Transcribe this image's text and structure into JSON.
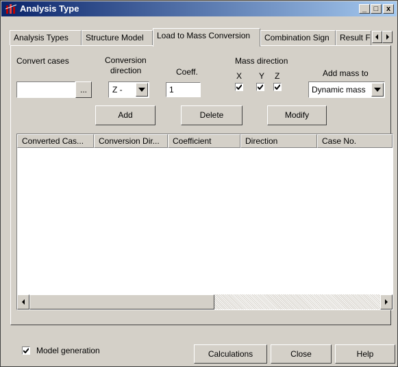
{
  "window": {
    "title": "Analysis Type",
    "minimize": "_",
    "maximize": "□",
    "close": "x"
  },
  "tabs": [
    {
      "label": "Analysis Types"
    },
    {
      "label": "Structure Model"
    },
    {
      "label": "Load to Mass Conversion"
    },
    {
      "label": "Combination Sign"
    },
    {
      "label": "Result F"
    }
  ],
  "form": {
    "convert_cases_label": "Convert cases",
    "convert_cases_value": "",
    "browse_label": "...",
    "conversion_direction_label_1": "Conversion",
    "conversion_direction_label_2": "direction",
    "conversion_direction_value": "Z -",
    "coeff_label": "Coeff.",
    "coeff_value": "1",
    "mass_direction_label": "Mass direction",
    "x_label": "X",
    "y_label": "Y",
    "z_label": "Z",
    "x_checked": true,
    "y_checked": true,
    "z_checked": true,
    "add_mass_to_label": "Add mass to",
    "add_mass_to_value": "Dynamic mass"
  },
  "buttons": {
    "add": "Add",
    "delete": "Delete",
    "modify": "Modify"
  },
  "table": {
    "columns": [
      "Converted Cas...",
      "Conversion Dir...",
      "Coefficient",
      "Direction",
      "Case No."
    ],
    "rows": []
  },
  "footer": {
    "model_generation_label": "Model generation",
    "model_generation_checked": true,
    "calculations": "Calculations",
    "close": "Close",
    "help": "Help"
  }
}
